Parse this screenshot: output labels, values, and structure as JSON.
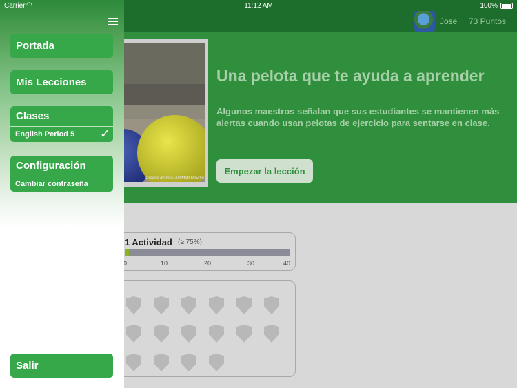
{
  "status_bar": {
    "carrier": "Carrier",
    "wifi_icon": "wifi-icon",
    "time": "11:12 AM",
    "battery_pct": "100%"
  },
  "topbar": {
    "username": "Jose",
    "points": "73 Puntos"
  },
  "hero": {
    "title": "Una pelota que te ayuda a aprender",
    "description": "Algunos maestros señalan que sus estudiantes se mantienen más alertas cuando usan pelotas de ejercicio para sentarse en clase.",
    "start_button": "Empezar la lección",
    "photo_credit": "Crédito de foto: AP/Matt Rourke"
  },
  "progress": {
    "title": "1 Actividad",
    "threshold": "(≥ 75%)",
    "value": 1,
    "max": 40,
    "ticks": [
      "0",
      "10",
      "20",
      "30",
      "40"
    ]
  },
  "badges": {
    "count": 16
  },
  "menu": {
    "home": "Portada",
    "my_lessons": "Mis Lecciones",
    "classes_header": "Clases",
    "class_item": "English Period 5",
    "class_check": "✓",
    "settings_header": "Configuración",
    "change_password": "Cambiar contraseña",
    "logout": "Salir"
  },
  "colors": {
    "brand_green": "#36a84a",
    "topbar_green": "#1d6e2c",
    "hero_green": "#2f8f3d",
    "progress_fill": "#8ab51e"
  }
}
